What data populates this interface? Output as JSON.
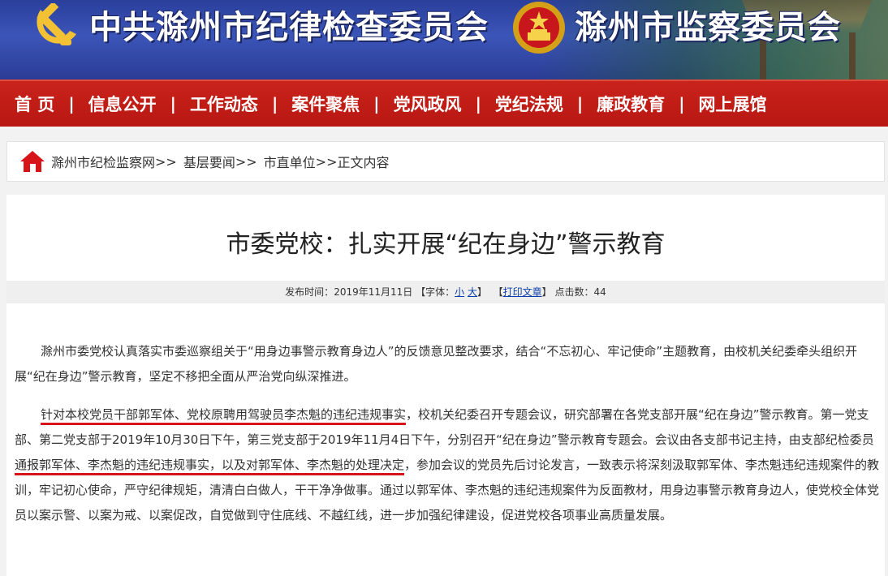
{
  "banner": {
    "left_title": "中共滁州市纪律检查委员会",
    "right_title": "滁州市监察委员会",
    "party_emblem_icon": "hammer-sickle-icon",
    "national_emblem_icon": "national-emblem-icon"
  },
  "nav": {
    "items": [
      "首 页",
      "信息公开",
      "工作动态",
      "案件聚焦",
      "党风政风",
      "党纪法规",
      "廉政教育",
      "网上展馆"
    ],
    "separator": "|"
  },
  "breadcrumb": {
    "icon": "home-icon",
    "items": [
      "滁州市纪检监察网",
      "基层要闻",
      "市直单位",
      "正文内容"
    ],
    "separator": ">>"
  },
  "article": {
    "title": "市委党校：扎实开展“纪在身边”警示教育",
    "meta": {
      "publish_label": "发布时间：",
      "publish_date": "2019年11月11日",
      "font_label": "【字体：",
      "font_small": "小",
      "font_large": "大",
      "font_close": "】",
      "print_open": "【",
      "print_label": "打印文章",
      "print_close": "】",
      "clicks_label": "点击数：",
      "clicks": "44"
    },
    "para1": "滁州市委党校认真落实市委巡察组关于“用身边事警示教育身边人”的反馈意见整改要求，结合“不忘初心、牢记使命”主题教育，由校机关纪委牵头组织开展“纪在身边”警示教育，坚定不移把全面从严治党向纵深推进。",
    "para2_hl1": "针对本校党员干部郭军体、党校原聘用驾驶员李杰魁的违纪违规事实",
    "para2_t1": "，校机关纪委召开专题会议，研究部署在各党支部开展“纪在身边”警示教育。第一党支部、第二党支部于2019年10月30日下午，第三党支部于2019年11月4日下午，分别召开“纪在身边”警示教育专题会。会议由各支部书记主持，由支部纪检委员",
    "para2_hl2": "通报郭军体、李杰魁的违纪违规事实，以及对郭军体、李杰魁的处理决定",
    "para2_t2": "，参加会议的党员先后讨论发言，一致表示将深刻汲取郭军体、李杰魁违纪违规案件的教训，牢记初心使命，严守纪律规矩，清清白白做人，干干净净做事。通过以郭军体、李杰魁的违纪违规案件为反面教材，用身边事警示教育身边人，使党校全体党员以案示警、以案为戒、以案促改，自觉做到守住底线、不越红线，进一步加强纪律建设，促进党校各项事业高质量发展。"
  },
  "colors": {
    "banner_blue": "#2b3f9c",
    "nav_red": "#c9231c",
    "underline_red": "#d8141b",
    "link_blue": "#0a3ea8"
  }
}
